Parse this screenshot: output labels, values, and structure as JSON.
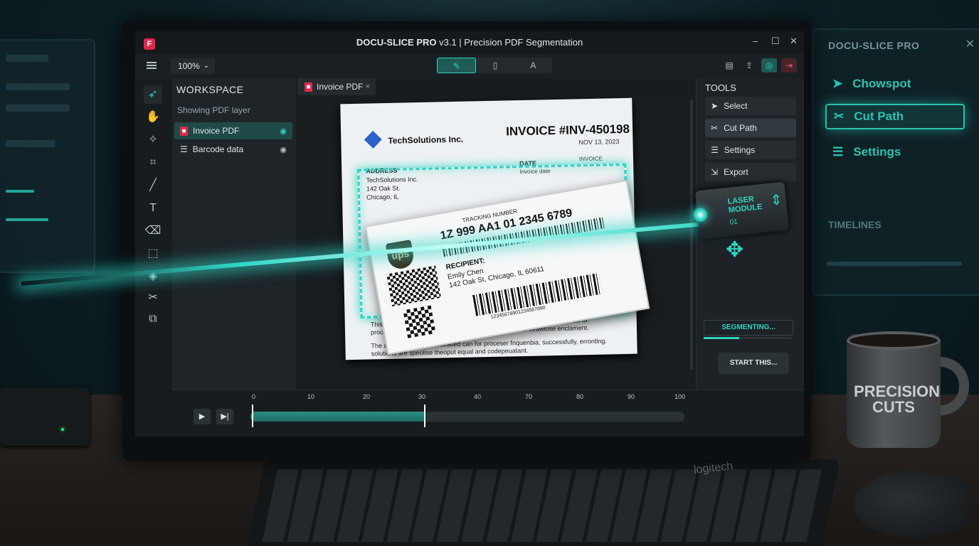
{
  "app": {
    "logo": "F",
    "title_bold": "DOCU-SLICE PRO",
    "title_rest": " v3.1 | Precision PDF Segmentation",
    "window_controls": {
      "minimize": "–",
      "maximize": "☐",
      "close": "✕"
    }
  },
  "toolbar": {
    "zoom": "100%",
    "zoom_icon": "chevron-down-icon",
    "modes": [
      {
        "icon": "edit-icon",
        "glyph": "✎",
        "active": true
      },
      {
        "icon": "page-icon",
        "glyph": "▯",
        "active": false
      },
      {
        "icon": "vector-icon",
        "glyph": "A",
        "active": false
      }
    ],
    "right_actions": [
      {
        "icon": "clipboard-icon",
        "glyph": "▤"
      },
      {
        "icon": "share-icon",
        "glyph": "⇪"
      },
      {
        "icon": "sync-icon",
        "glyph": "◎"
      },
      {
        "icon": "logout-icon",
        "glyph": "⇥"
      }
    ]
  },
  "toolstrip": [
    {
      "icon": "select-arrow-icon",
      "glyph": "➶",
      "active": true
    },
    {
      "icon": "hand-icon",
      "glyph": "✋"
    },
    {
      "icon": "magic-wand-icon",
      "glyph": "✧"
    },
    {
      "icon": "crop-icon",
      "glyph": "⌗"
    },
    {
      "icon": "pen-icon",
      "glyph": "╱"
    },
    {
      "icon": "text-icon",
      "glyph": "T"
    },
    {
      "icon": "eraser-icon",
      "glyph": "⌫"
    },
    {
      "icon": "marquee-icon",
      "glyph": "⬚"
    },
    {
      "icon": "layers-icon",
      "glyph": "◈"
    },
    {
      "icon": "scissors-icon",
      "glyph": "✂"
    },
    {
      "icon": "overlap-icon",
      "glyph": "⧉"
    }
  ],
  "workspace": {
    "title": "WORKSPACE",
    "subtitle": "Showing PDF layer",
    "layers": [
      {
        "label": "Invoice PDF",
        "active": true
      },
      {
        "label": "Barcode data",
        "active": false
      }
    ]
  },
  "doc_tab": {
    "label": "Invoice PDF",
    "close": "×"
  },
  "document": {
    "company": "TechSolutions Inc.",
    "invoice_no": "INVOICE #INV-450198",
    "invoice_date": "NOV 13, 2023",
    "address_label": "ADDRESS",
    "address_lines": [
      "TechSolutions Inc.",
      "142 Oak St.",
      "Chicago, IL"
    ],
    "date_label": "DATE",
    "date_value": "Invoice date",
    "invoice_col": "INVOICE",
    "body_1": "This program is normal solve main cordetsfer high and dialerese ane Dats to processt and paniles and unoomvable catopscruiec will oirawlose enclament.",
    "body_2": "The account has the conoraited can for proceser fnquenbia, successfully, errontlng. solutions are speolise theoput equal and codepeuatant."
  },
  "shipping_label": {
    "carrier": "ups",
    "tracking_label": "TRACKING NUMBER",
    "tracking_number": "1Z 999 AA1 01 2345 6789",
    "recipient_label": "RECIPIENT:",
    "recipient_name": "Emily Chen",
    "recipient_address": "142 Oak St, Chicago, IL 60611",
    "barcode_number": "12345678901234567890"
  },
  "tools_panel": {
    "title": "TOOLS",
    "buttons": [
      {
        "label": "Select",
        "icon": "cursor-icon",
        "glyph": "➤",
        "active": false
      },
      {
        "label": "Cut Path",
        "icon": "scissors-icon",
        "glyph": "✂",
        "active": true
      },
      {
        "label": "Settings",
        "icon": "sliders-icon",
        "glyph": "☰",
        "active": false
      },
      {
        "label": "Export",
        "icon": "export-icon",
        "glyph": "⇲",
        "active": false
      }
    ],
    "status": "SEGMENTING...",
    "status_progress": 0.4,
    "start_button": "START THIS..."
  },
  "timeline": {
    "play_glyph": "▶",
    "next_glyph": "▶|",
    "ticks": [
      "0",
      "10",
      "20",
      "30",
      "40",
      "70",
      "80",
      "90",
      "100"
    ],
    "progress": 0.4
  },
  "laser": {
    "label_line1": "LASER",
    "label_line2": "MODULE",
    "sub": "01",
    "arrow_glyph": "⇕",
    "move_glyph": "✥"
  },
  "side_monitor": {
    "title": "DOCU-SLICE PRO",
    "close": "✕",
    "items": [
      {
        "label": "Chowspot",
        "icon": "arrow-icon",
        "glyph": "➤",
        "active": false
      },
      {
        "label": "Cut Path",
        "icon": "scissors-icon",
        "glyph": "✂",
        "active": true
      },
      {
        "label": "Settings",
        "icon": "sliders-icon",
        "glyph": "☰",
        "active": false
      }
    ],
    "timelines": "TIMELINES"
  },
  "mug": {
    "text": "PRECISION CUTS"
  },
  "keyboard_brand": "logitech",
  "colors": {
    "accent": "#2fd4c4",
    "brand": "#e0284c",
    "panel": "#1c2226"
  }
}
